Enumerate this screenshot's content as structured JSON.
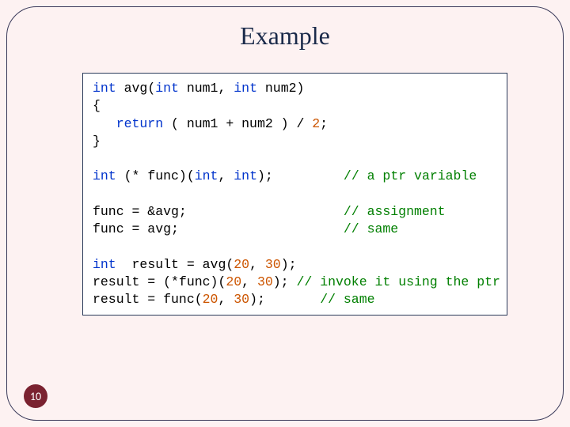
{
  "title": "Example",
  "page_number": "10",
  "code": {
    "l1": "int",
    "l1b": " avg(",
    "l1c": "int",
    "l1d": " num1, ",
    "l1e": "int",
    "l1f": " num2)",
    "l2": "{",
    "l3a": "   return",
    "l3b": " ( num1 + num2 ) / ",
    "l3c": "2",
    "l3d": ";",
    "l4": "}",
    "blank1": " ",
    "l5a": "int",
    "l5b": " (* func)(",
    "l5c": "int",
    "l5d": ", ",
    "l5e": "int",
    "l5f": ");         ",
    "l5g": "// a ptr variable",
    "blank2": " ",
    "l6a": "func = &avg;                    ",
    "l6b": "// assignment",
    "l7a": "func = avg;                     ",
    "l7b": "// same",
    "blank3": " ",
    "l8a": "int",
    "l8b": "  result = avg(",
    "l8c": "20",
    "l8d": ", ",
    "l8e": "30",
    "l8f": ");",
    "l9a": "result = (*func)(",
    "l9b": "20",
    "l9c": ", ",
    "l9d": "30",
    "l9e": "); ",
    "l9f": "// invoke it using the ptr",
    "l10a": "result = func(",
    "l10b": "20",
    "l10c": ", ",
    "l10d": "30",
    "l10e": ");       ",
    "l10f": "// same"
  }
}
